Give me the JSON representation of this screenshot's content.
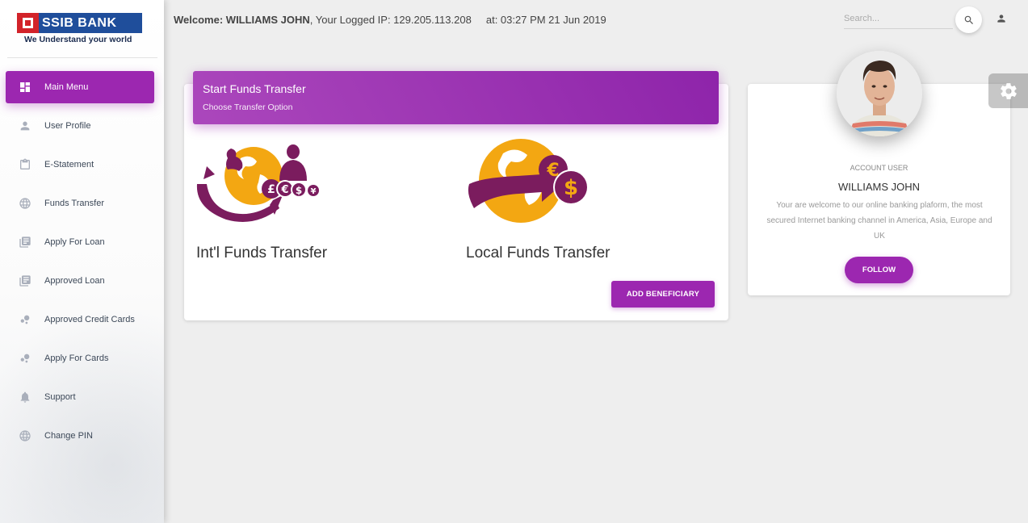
{
  "brand": {
    "name": "SSIB BANK",
    "tagline": "We Understand your world",
    "colors": {
      "red": "#d2232a",
      "blue": "#1f4e9b"
    }
  },
  "theme": {
    "accent": "#9c27b0",
    "icon_gold": "#f3a712",
    "icon_plum": "#7b1c5e"
  },
  "sidebar": {
    "items": [
      {
        "label": "Main Menu",
        "icon": "dashboard-icon",
        "active": true
      },
      {
        "label": "User Profile",
        "icon": "person-icon"
      },
      {
        "label": "E-Statement",
        "icon": "clipboard-icon"
      },
      {
        "label": "Funds Transfer",
        "icon": "globe-icon"
      },
      {
        "label": "Apply For Loan",
        "icon": "library-books-icon"
      },
      {
        "label": "Approved Loan",
        "icon": "library-books-icon"
      },
      {
        "label": "Approved Credit Cards",
        "icon": "bubble-chart-icon"
      },
      {
        "label": "Apply For Cards",
        "icon": "bubble-chart-icon"
      },
      {
        "label": "Support",
        "icon": "bell-icon"
      },
      {
        "label": "Change PIN",
        "icon": "globe-icon"
      }
    ]
  },
  "topbar": {
    "welcome_prefix": "Welcome:",
    "user_name": "WILLIAMS JOHN",
    "ip_label": ", Your Logged IP: 129.205.113.208",
    "time_label": "at: 03:27 PM 21 Jun 2019",
    "search_placeholder": "Search..."
  },
  "transfer_card": {
    "title": "Start Funds Transfer",
    "subtitle": "Choose Transfer Option",
    "options": [
      {
        "label": "Int'l Funds Transfer",
        "icon": "international-transfer-icon"
      },
      {
        "label": "Local Funds Transfer",
        "icon": "local-transfer-icon"
      }
    ],
    "add_button": "ADD BENEFICIARY"
  },
  "profile": {
    "role": "ACCOUNT USER",
    "name": "WILLIAMS JOHN",
    "description": "Your are welcome to our online banking plaform, the most secured Internet banking channel in America, Asia, Europe and UK",
    "follow_button": "FOLLOW"
  }
}
